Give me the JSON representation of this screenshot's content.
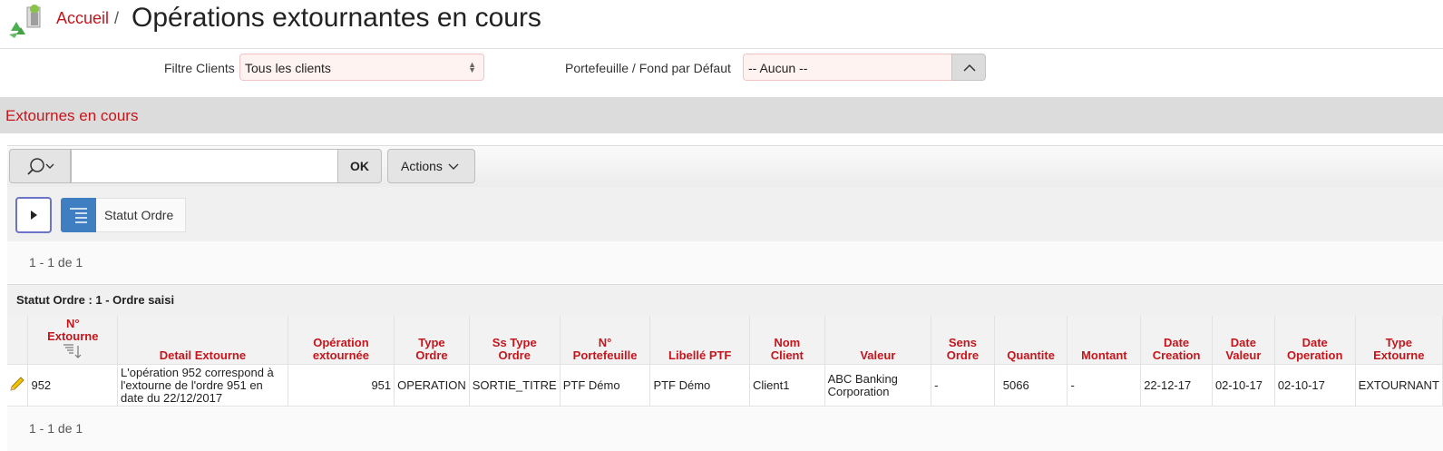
{
  "header": {
    "breadcrumb_home": "Accueil",
    "separator": "/",
    "title": "Opérations extournantes en cours"
  },
  "filters": {
    "clients_label": "Filtre Clients",
    "clients_value": "Tous les clients",
    "portefeuille_label": "Portefeuille / Fond par Défaut",
    "portefeuille_value": "-- Aucun --"
  },
  "region": {
    "title": "Extournes en cours"
  },
  "toolbar": {
    "search_value": "",
    "ok_label": "OK",
    "actions_label": "Actions"
  },
  "control_break": {
    "label": "Statut Ordre"
  },
  "pagination": {
    "top": "1 - 1 de 1",
    "bottom": "1 - 1 de 1"
  },
  "group": {
    "label": "Statut Ordre : 1 - Ordre saisi"
  },
  "table": {
    "columns": [
      {
        "line1": "N°",
        "line2": "Extourne"
      },
      {
        "line1": "",
        "line2": "Detail Extourne"
      },
      {
        "line1": "Opération",
        "line2": "extournée"
      },
      {
        "line1": "Type",
        "line2": "Ordre"
      },
      {
        "line1": "Ss Type",
        "line2": "Ordre"
      },
      {
        "line1": "N°",
        "line2": "Portefeuille"
      },
      {
        "line1": "",
        "line2": "Libellé PTF"
      },
      {
        "line1": "Nom",
        "line2": "Client"
      },
      {
        "line1": "",
        "line2": "Valeur"
      },
      {
        "line1": "Sens",
        "line2": "Ordre"
      },
      {
        "line1": "",
        "line2": "Quantite"
      },
      {
        "line1": "",
        "line2": "Montant"
      },
      {
        "line1": "Date",
        "line2": "Creation"
      },
      {
        "line1": "Date",
        "line2": "Valeur"
      },
      {
        "line1": "Date",
        "line2": "Operation"
      },
      {
        "line1": "Type",
        "line2": "Extourne"
      }
    ],
    "rows": [
      {
        "no_extourne": "952",
        "detail": "L'opération 952 correspond à l'extourne de l'ordre 951 en date du 22/12/2017",
        "operation_extournee": "951",
        "type_ordre": "OPERATION",
        "ss_type_ordre": "SORTIE_TITRE",
        "no_portefeuille": "PTF Démo",
        "libelle_ptf": "PTF Démo",
        "nom_client": "Client1",
        "valeur": "ABC Banking Corporation",
        "sens_ordre": "-",
        "quantite": "5066",
        "montant": "-",
        "date_creation": "22-12-17",
        "date_valeur": "02-10-17",
        "date_operation": "02-10-17",
        "type_extourne": "EXTOURNANT"
      }
    ]
  },
  "colors": {
    "accent_red": "#c4161c",
    "accent_blue": "#3f7fc1"
  }
}
